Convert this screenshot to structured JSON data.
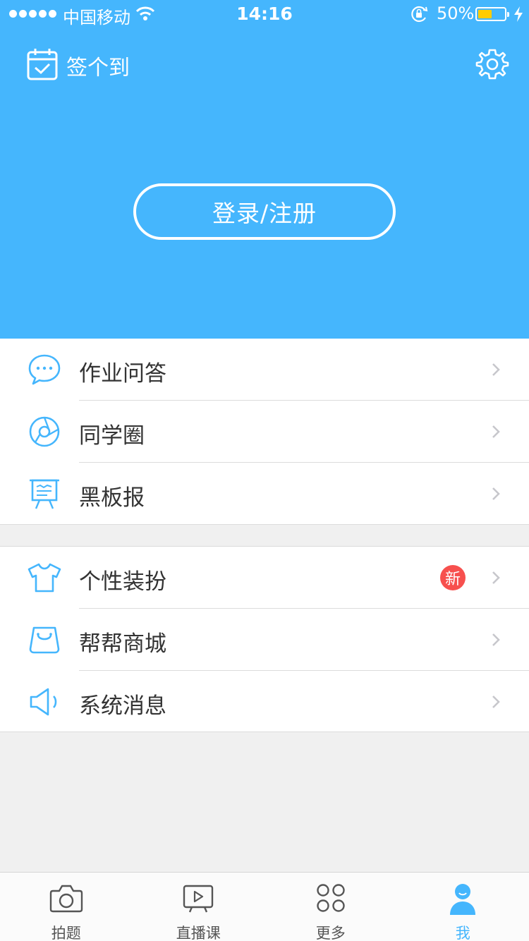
{
  "status_bar": {
    "carrier": "中国移动",
    "time": "14:16",
    "battery_percent": "50%",
    "battery_level": 0.5,
    "battery_color": "#ffcc00"
  },
  "header": {
    "checkin_label": "签个到",
    "checkin_icon": "calendar-check-icon",
    "settings_icon": "gear-icon",
    "login_label": "登录/注册",
    "background_color": "#45b6fd"
  },
  "menu_group_1": [
    {
      "label": "作业问答",
      "icon": "chat-bubble-icon"
    },
    {
      "label": "同学圈",
      "icon": "aperture-icon"
    },
    {
      "label": "黑板报",
      "icon": "blackboard-icon"
    }
  ],
  "menu_group_2": [
    {
      "label": "个性装扮",
      "icon": "tshirt-icon",
      "badge": "新"
    },
    {
      "label": "帮帮商城",
      "icon": "shopping-bag-icon"
    },
    {
      "label": "系统消息",
      "icon": "speaker-icon"
    }
  ],
  "tabbar": {
    "active_index": 3,
    "active_color": "#45b6fd",
    "items": [
      {
        "label": "拍题",
        "icon": "camera-icon"
      },
      {
        "label": "直播课",
        "icon": "live-play-icon"
      },
      {
        "label": "更多",
        "icon": "grid-circles-icon"
      },
      {
        "label": "我",
        "icon": "user-icon"
      }
    ]
  }
}
